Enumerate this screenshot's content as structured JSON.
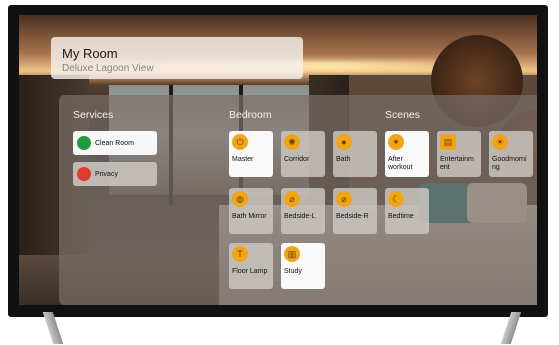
{
  "header": {
    "title": "My Room",
    "subtitle": "Deluxe Lagoon View"
  },
  "sections": {
    "services_title": "Services",
    "bedroom_title": "Bedroom",
    "scenes_title": "Scenes"
  },
  "services": [
    {
      "label": "Clean Room",
      "color": "#1f9b3a",
      "state": "on"
    },
    {
      "label": "Privacy",
      "color": "#e23b2e",
      "state": "off"
    }
  ],
  "bedroom": [
    {
      "label": "Master",
      "icon": "power-icon",
      "state": "on"
    },
    {
      "label": "Corridor",
      "icon": "light-icon",
      "state": "off"
    },
    {
      "label": "Bath",
      "icon": "bulb-icon",
      "state": "off"
    },
    {
      "label": "Bath Mirror",
      "icon": "mirror-icon",
      "state": "off"
    },
    {
      "label": "Bedside-L",
      "icon": "lamp-icon",
      "state": "off"
    },
    {
      "label": "Bedside-R",
      "icon": "lamp-icon",
      "state": "off"
    },
    {
      "label": "Floor Lamp",
      "icon": "floor-lamp-icon",
      "state": "off"
    },
    {
      "label": "Study",
      "icon": "book-icon",
      "state": "on"
    }
  ],
  "scenes": [
    {
      "label": "After workout",
      "icon": "dumbbell-icon",
      "state": "on"
    },
    {
      "label": "Entertainm ent",
      "icon": "film-icon",
      "state": "off"
    },
    {
      "label": "Goodmorni ng",
      "icon": "sun-icon",
      "state": "off"
    },
    {
      "label": "Bedtime",
      "icon": "moon-icon",
      "state": "off"
    }
  ],
  "colors": {
    "accent": "#f1a516",
    "panel": "#786e68",
    "tile_on": "#f9f9f9"
  }
}
